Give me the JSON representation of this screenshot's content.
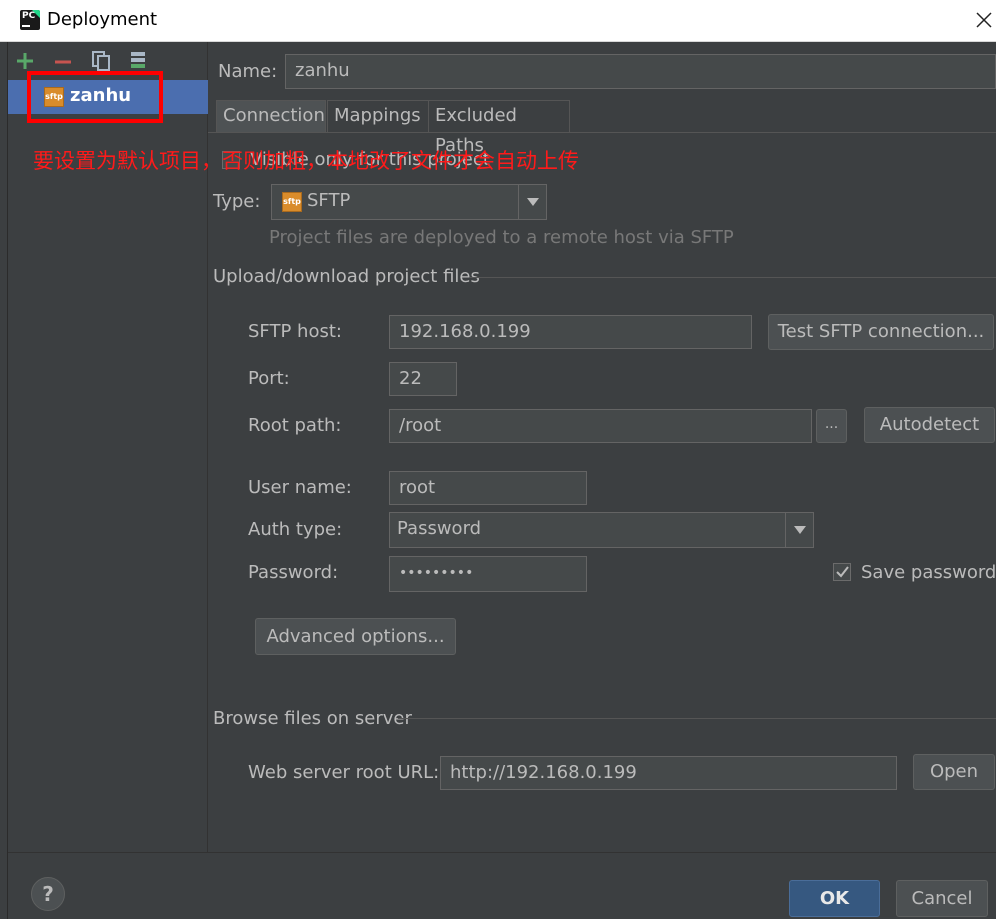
{
  "window": {
    "title": "Deployment"
  },
  "toolbar": {
    "add_icon": "plus-icon",
    "remove_icon": "minus-icon",
    "copy_icon": "copy-icon",
    "default_icon": "set-default-server-icon"
  },
  "servers": [
    {
      "label": "zanhu",
      "icon": "sftp",
      "selected": true
    }
  ],
  "annotation": "要设置为默认项目，否则加粗，本地改了文件才会自动上传",
  "form": {
    "name_label": "Name:",
    "name_value": "zanhu",
    "tabs": [
      "Connection",
      "Mappings",
      "Excluded Paths"
    ],
    "visible_only_label": "Visible only for this project",
    "visible_only_checked": false,
    "type_label": "Type:",
    "type_value": "SFTP",
    "type_icon_text": "sftp",
    "type_hint": "Project files are deployed to a remote host via SFTP",
    "upload_section": "Upload/download project files",
    "host_label": "SFTP host:",
    "host_value": "192.168.0.199",
    "test_button": "Test SFTP connection...",
    "port_label": "Port:",
    "port_value": "22",
    "root_path_label": "Root path:",
    "root_path_value": "/root",
    "browse_button": "...",
    "autodetect_button": "Autodetect",
    "username_label": "User name:",
    "username_value": "root",
    "auth_type_label": "Auth type:",
    "auth_type_value": "Password",
    "password_label": "Password:",
    "password_value": "•••••••••",
    "save_password_label": "Save password",
    "save_password_checked": true,
    "advanced_button": "Advanced options...",
    "browse_section": "Browse files on server",
    "web_url_label": "Web server root URL:",
    "web_url_value": "http://192.168.0.199",
    "open_button": "Open"
  },
  "footer": {
    "help": "?",
    "ok": "OK",
    "cancel": "Cancel"
  },
  "colors": {
    "bg": "#3c3f41",
    "selection": "#4b6eaf",
    "field_bg": "#45494a",
    "annotation": "#ff1a1a",
    "ok_button": "#365880"
  }
}
